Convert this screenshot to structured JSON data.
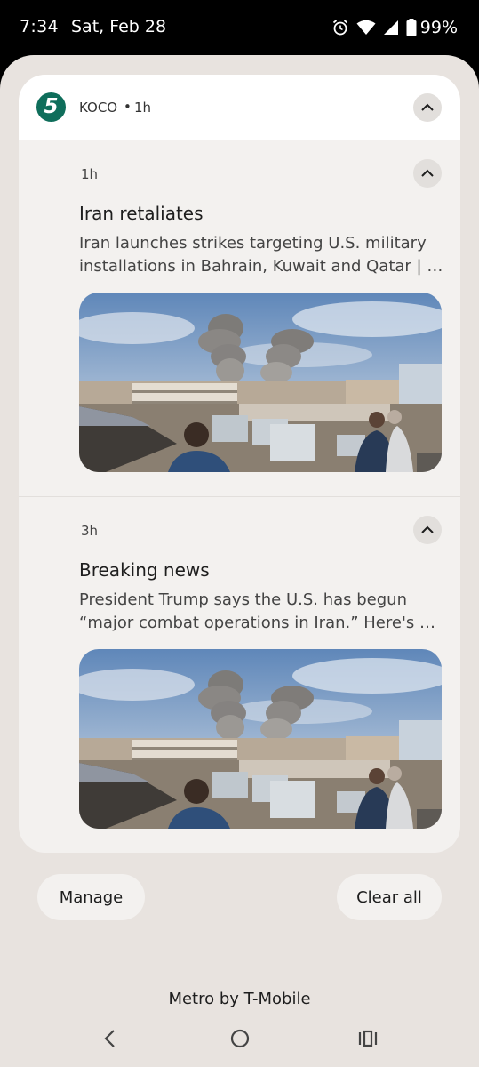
{
  "status_bar": {
    "time": "7:34",
    "date": "Sat, Feb 28",
    "battery_percent": "99%",
    "icons": [
      "alarm-icon",
      "wifi-icon",
      "signal-icon",
      "battery-icon"
    ]
  },
  "notification_group": {
    "app_logo_text": "5",
    "app_name": "KOCO",
    "separator": "•",
    "age": "1h",
    "logo_color": "#0f6e5b"
  },
  "notifications": [
    {
      "time": "1h",
      "title": "Iran retaliates",
      "body_line1": "Iran launches strikes targeting U.S. military",
      "body_line2": "installations in Bahrain, Kuwait and Qatar | He..."
    },
    {
      "time": "3h",
      "title": "Breaking news",
      "body_line1": "President Trump says the U.S. has begun",
      "body_line2": "“major combat operations in Iran.” Here's wh..."
    }
  ],
  "actions": {
    "manage_label": "Manage",
    "clear_all_label": "Clear all"
  },
  "carrier": "Metro by T-Mobile",
  "nav": [
    "back-icon",
    "home-icon",
    "recents-icon"
  ]
}
